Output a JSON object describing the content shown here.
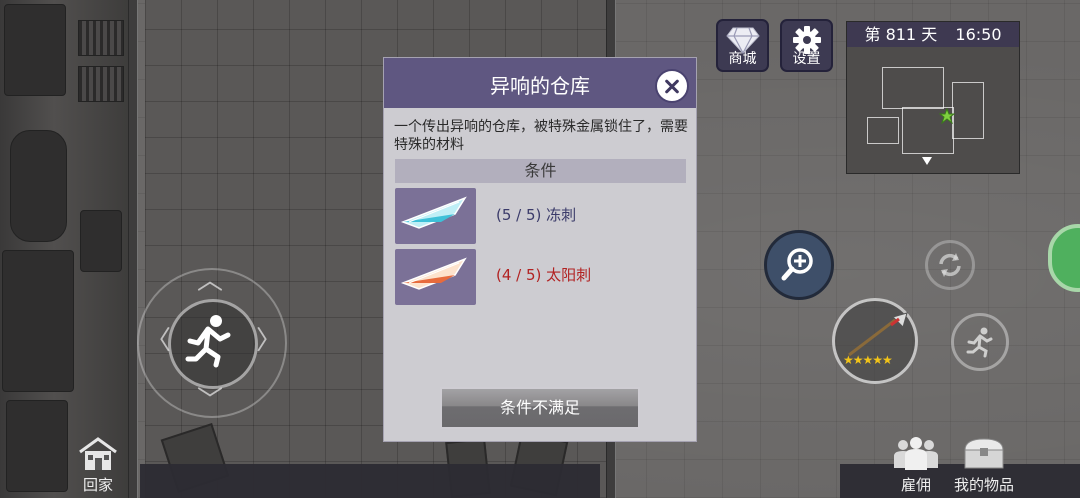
{
  "hud": {
    "store_label": "商城",
    "settings_label": "设置",
    "minimap_day": "第 811 天",
    "minimap_time": "16:50"
  },
  "nav": {
    "home_label": "回家",
    "hire_label": "雇佣",
    "items_label": "我的物品"
  },
  "dialog": {
    "title": "异响的仓库",
    "description": "一个传出异响的仓库，被特殊金属锁住了，需要特殊的材料",
    "conditions_header": "条件",
    "requirements": [
      {
        "progress": "(5 / 5)",
        "name": "冻刺",
        "met": true,
        "color": "#3b3b6a",
        "icon": "ice-thorn-icon"
      },
      {
        "progress": "(4 / 5)",
        "name": "太阳刺",
        "met": false,
        "color": "#b22222",
        "icon": "sun-thorn-icon"
      }
    ],
    "action_label": "条件不满足"
  },
  "weapon": {
    "icon": "spear-icon",
    "stars": 5,
    "star_color": "#f2c418"
  },
  "colors": {
    "dialog_header": "#5f5781",
    "dialog_body": "#cdccd1",
    "hud_button": "#3d3a52",
    "green_tab": "#4fb05e"
  }
}
